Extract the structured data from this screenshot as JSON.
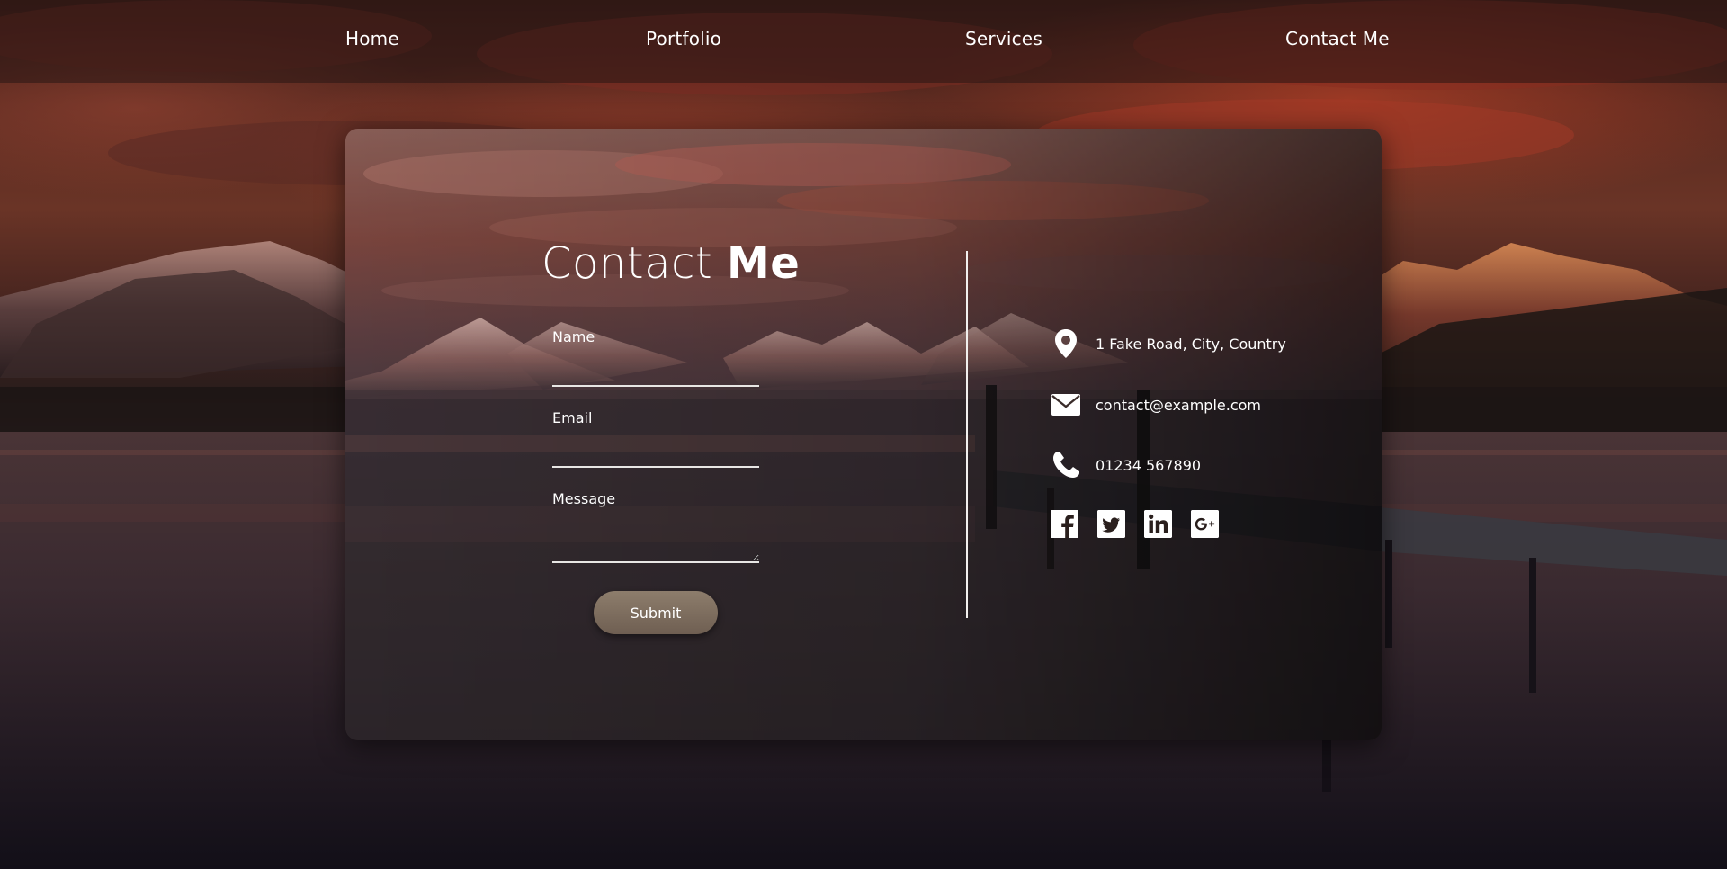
{
  "nav": {
    "items": [
      {
        "label": "Home"
      },
      {
        "label": "Portfolio"
      },
      {
        "label": "Services"
      },
      {
        "label": "Contact Me"
      }
    ]
  },
  "contact": {
    "heading_light": "Contact",
    "heading_bold": "Me",
    "form": {
      "name_label": "Name",
      "name_value": "",
      "email_label": "Email",
      "email_value": "",
      "message_label": "Message",
      "message_value": "",
      "submit_label": "Submit"
    },
    "info": {
      "address": "1 Fake Road, City, Country",
      "email": "contact@example.com",
      "phone": "01234 567890"
    },
    "social": [
      {
        "icon": "facebook-icon"
      },
      {
        "icon": "twitter-icon"
      },
      {
        "icon": "linkedin-icon"
      },
      {
        "icon": "google-plus-icon"
      }
    ]
  },
  "colors": {
    "accent_button": "#7d6d5e",
    "text": "#ffffff"
  }
}
